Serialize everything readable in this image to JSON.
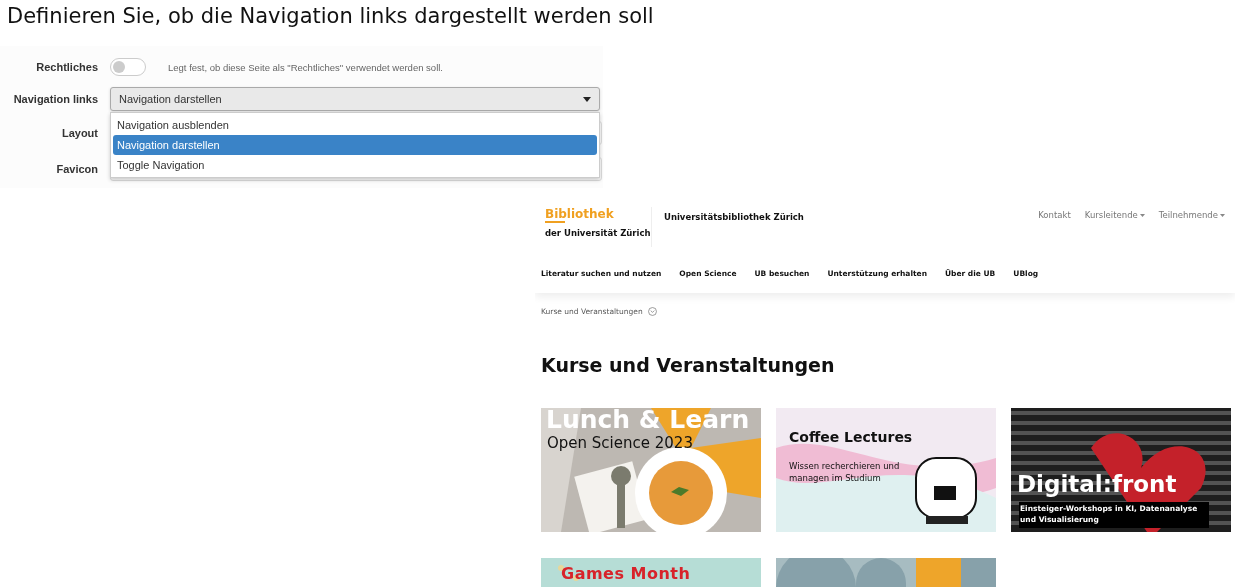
{
  "heading": "Definieren Sie, ob die Navigation links dargestellt werden soll",
  "form": {
    "legal": {
      "label": "Rechtliches",
      "on": false,
      "hint": "Legt fest, ob diese Seite als \"Rechtliches\" verwendet werden soll."
    },
    "navigation": {
      "label": "Navigation links",
      "value": "Navigation darstellen",
      "expanded": true,
      "options": [
        {
          "label": "Navigation ausblenden",
          "selected": false
        },
        {
          "label": "Navigation darstellen",
          "selected": true
        },
        {
          "label": "Toggle Navigation",
          "selected": false
        }
      ]
    },
    "other_labels": [
      "Layout",
      "Favicon"
    ]
  },
  "website": {
    "logo": {
      "title": "Bibliothek",
      "subtitle": "der Universität Zürich"
    },
    "site_name": "Universitätsbibliothek Zürich",
    "top_links": [
      {
        "label": "Kontakt",
        "dropdown": false
      },
      {
        "label": "Kursleitende",
        "dropdown": true
      },
      {
        "label": "Teilnehmende",
        "dropdown": true
      }
    ],
    "nav": [
      "Literatur suchen und nutzen",
      "Open Science",
      "UB besuchen",
      "Unterstützung erhalten",
      "Über die UB",
      "UBlog"
    ],
    "breadcrumb": "Kurse und Veranstaltungen",
    "page_title": "Kurse und Veranstaltungen",
    "cards": [
      {
        "kind": "lunch",
        "title": "Lunch & Learn",
        "subtitle": "Open Science 2023"
      },
      {
        "kind": "coffee",
        "title": "Coffee Lectures",
        "subtitle": "Wissen recherchieren und managen im Studium"
      },
      {
        "kind": "digital",
        "title": "Digital:front",
        "subtitle": "Einsteiger-Workshops in KI, Datenanalyse und Visualisierung"
      },
      {
        "kind": "games",
        "title": "Games Month"
      },
      {
        "kind": "shapes"
      }
    ]
  }
}
